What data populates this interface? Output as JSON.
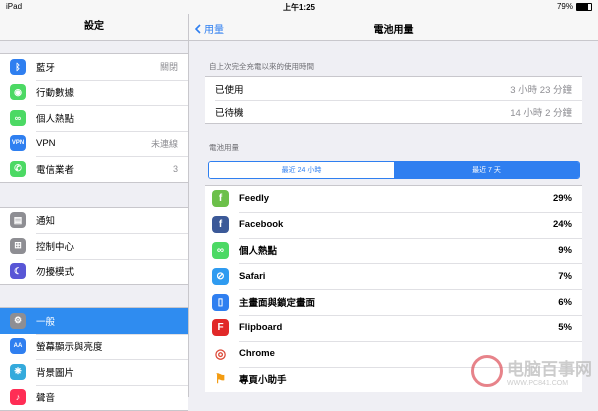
{
  "status": {
    "left": "iPad",
    "time": "上午1:25",
    "battery": "79%"
  },
  "sidebar": {
    "title": "設定",
    "groups": [
      [
        {
          "label": "藍牙",
          "value": "關閉",
          "icon": "bluetooth-icon",
          "color": "#2f7ff0",
          "glyph": "ᛒ"
        },
        {
          "label": "行動數據",
          "value": "",
          "icon": "antenna-icon",
          "color": "#4cd964",
          "glyph": "◉"
        },
        {
          "label": "個人熱點",
          "value": "",
          "icon": "hotspot-icon",
          "color": "#4cd964",
          "glyph": "∞"
        },
        {
          "label": "VPN",
          "value": "未連線",
          "icon": "vpn-icon",
          "color": "#2f7ff0",
          "glyph": "VPN"
        },
        {
          "label": "電信業者",
          "value": "3",
          "icon": "phone-icon",
          "color": "#4cd964",
          "glyph": "✆"
        }
      ],
      [
        {
          "label": "通知",
          "value": "",
          "icon": "notifications-icon",
          "color": "#8e8e93",
          "glyph": "▤"
        },
        {
          "label": "控制中心",
          "value": "",
          "icon": "control-center-icon",
          "color": "#8e8e93",
          "glyph": "⊞"
        },
        {
          "label": "勿擾模式",
          "value": "",
          "icon": "moon-icon",
          "color": "#5856d6",
          "glyph": "☾"
        }
      ],
      [
        {
          "label": "一般",
          "value": "",
          "icon": "gear-icon",
          "color": "#8e8e93",
          "glyph": "⚙",
          "selected": true
        },
        {
          "label": "螢幕顯示與亮度",
          "value": "",
          "icon": "display-icon",
          "color": "#2f7ff0",
          "glyph": "AA"
        },
        {
          "label": "背景圖片",
          "value": "",
          "icon": "wallpaper-icon",
          "color": "#34aadc",
          "glyph": "❋"
        },
        {
          "label": "聲音",
          "value": "",
          "icon": "sound-icon",
          "color": "#ff2d55",
          "glyph": "♪"
        }
      ]
    ]
  },
  "main": {
    "back_label": "用量",
    "title": "電池用量",
    "usage_header": "自上次完全充電以來的使用時間",
    "usage_rows": [
      {
        "label": "已使用",
        "value": "3 小時 23 分鐘"
      },
      {
        "label": "已待機",
        "value": "14 小時 2 分鐘"
      }
    ],
    "battery_header": "電池用量",
    "segments": [
      {
        "label": "最近 24 小時",
        "active": false
      },
      {
        "label": "最近 7 天",
        "active": true
      }
    ],
    "apps": [
      {
        "name": "Feedly",
        "pct": "29%",
        "icon": "feedly-icon",
        "color": "#6cc04a",
        "glyph": "f"
      },
      {
        "name": "Facebook",
        "pct": "24%",
        "icon": "facebook-icon",
        "color": "#3b5998",
        "glyph": "f"
      },
      {
        "name": "個人熱點",
        "pct": "9%",
        "icon": "hotspot-icon",
        "color": "#4cd964",
        "glyph": "∞"
      },
      {
        "name": "Safari",
        "pct": "7%",
        "icon": "safari-icon",
        "color": "#2f9bf0",
        "glyph": "⊘"
      },
      {
        "name": "主畫面與鎖定畫面",
        "pct": "6%",
        "icon": "homescreen-icon",
        "color": "#2f7ff0",
        "glyph": "▯"
      },
      {
        "name": "Flipboard",
        "pct": "5%",
        "icon": "flipboard-icon",
        "color": "#e12828",
        "glyph": "F"
      },
      {
        "name": "Chrome",
        "pct": "",
        "icon": "chrome-icon",
        "color": "#ffffff",
        "glyph": "◎"
      },
      {
        "name": "專頁小助手",
        "pct": "",
        "icon": "flag-icon",
        "color": "#ffffff",
        "glyph": "⚑"
      }
    ]
  },
  "watermark": {
    "text": "电脑百事网",
    "url": "WWW.PC841.COM"
  }
}
